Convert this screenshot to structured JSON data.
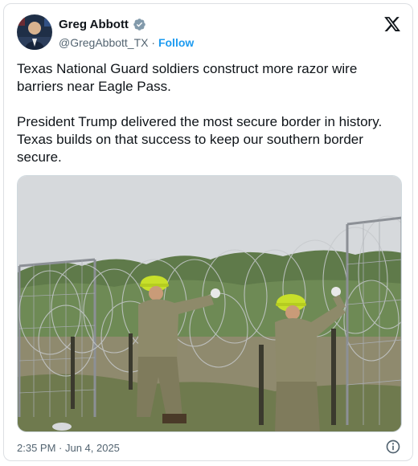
{
  "author": {
    "display_name": "Greg Abbott",
    "handle": "@GregAbbott_TX",
    "separator": "·",
    "follow_label": "Follow",
    "verified_color": "#829aab"
  },
  "tweet": {
    "paragraphs": [
      "Texas National Guard soldiers construct more razor wire barriers near Eagle Pass.",
      "President Trump delivered the most secure border in history. Texas builds on that success to keep our southern border secure."
    ],
    "timestamp": "2:35 PM · Jun 4, 2025"
  },
  "media": {
    "description_icon": "photo-soldiers-razor-wire"
  },
  "icons": {
    "brand": "x-logo-icon",
    "info": "info-icon",
    "verified": "verified-badge-icon"
  },
  "colors": {
    "link": "#1d9bf0",
    "secondary_text": "#536471",
    "text": "#0f1419"
  }
}
